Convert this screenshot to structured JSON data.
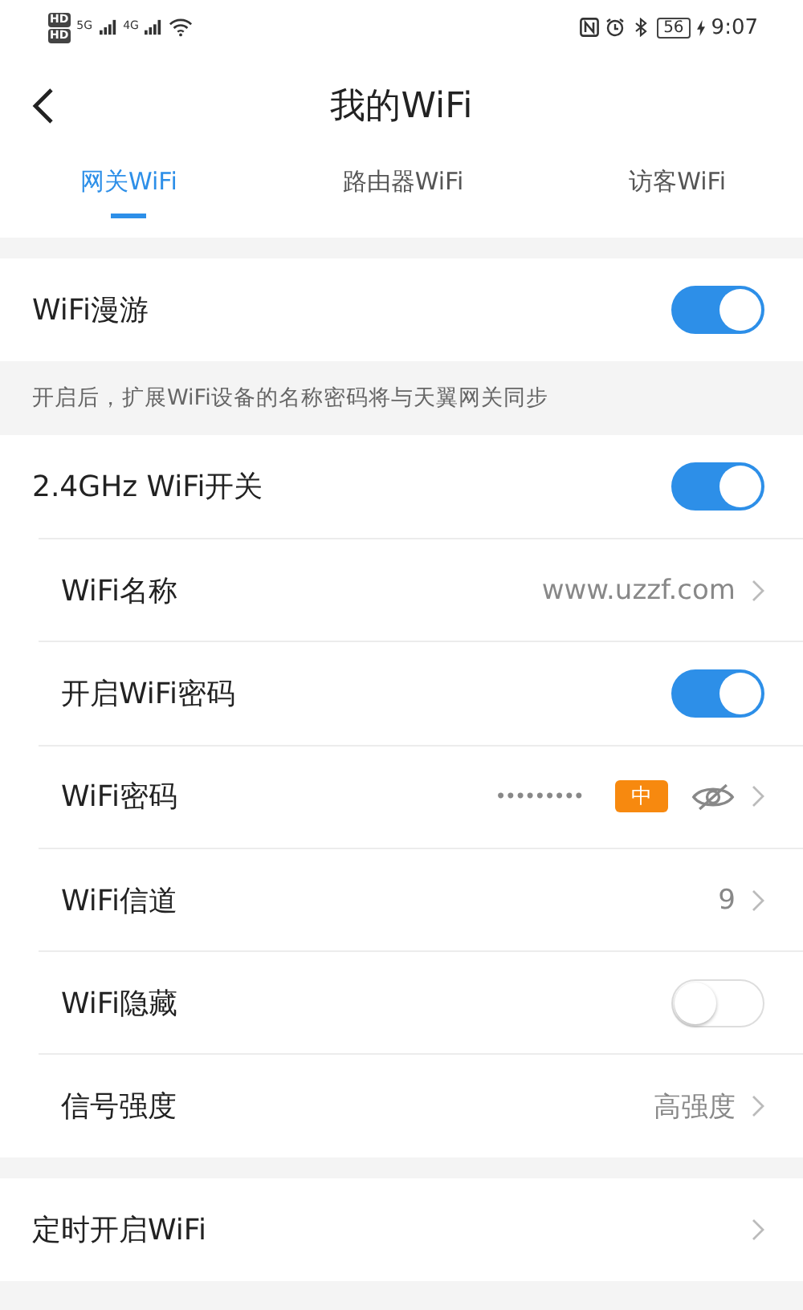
{
  "status_bar": {
    "sim_labels": [
      "HD",
      "HD"
    ],
    "networks": [
      "5G",
      "4G"
    ],
    "battery": "56",
    "time": "9:07"
  },
  "title": "我的WiFi",
  "tabs": [
    {
      "label": "网关WiFi",
      "selected": true
    },
    {
      "label": "路由器WiFi",
      "selected": false
    },
    {
      "label": "访客WiFi",
      "selected": false
    }
  ],
  "roaming": {
    "label": "WiFi漫游",
    "on": true,
    "note": "开启后，扩展WiFi设备的名称密码将与天翼网关同步"
  },
  "band": {
    "label": "2.4GHz WiFi开关",
    "on": true,
    "rows": [
      {
        "kind": "value",
        "label": "WiFi名称",
        "value": "www.uzzf.com"
      },
      {
        "kind": "toggle",
        "label": "开启WiFi密码",
        "on": true
      },
      {
        "kind": "password",
        "label": "WiFi密码",
        "value": "•••••••••",
        "strength": "中"
      },
      {
        "kind": "value",
        "label": "WiFi信道",
        "value": "9"
      },
      {
        "kind": "toggle",
        "label": "WiFi隐藏",
        "on": false
      },
      {
        "kind": "value",
        "label": "信号强度",
        "value": "高强度"
      }
    ]
  },
  "schedule": {
    "label": "定时开启WiFi"
  }
}
